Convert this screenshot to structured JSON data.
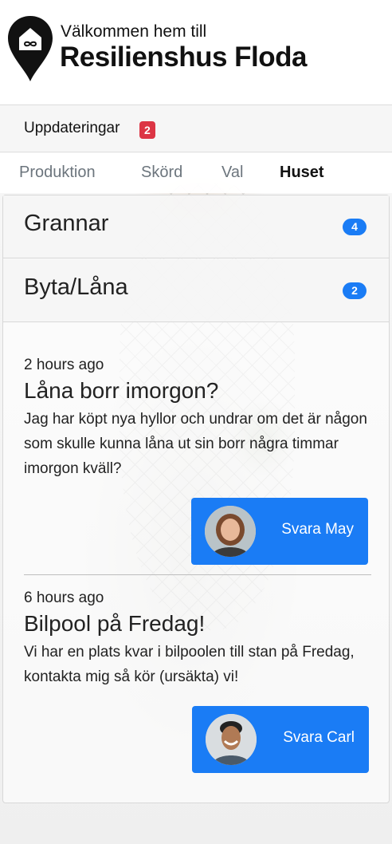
{
  "header": {
    "welcome": "Välkommen hem till",
    "site_name": "Resilienshus Floda"
  },
  "updates": {
    "label": "Uppdateringar",
    "count": "2"
  },
  "tabs": [
    {
      "label": "Produktion",
      "active": false
    },
    {
      "label": "Skörd",
      "active": false
    },
    {
      "label": "Val",
      "active": false
    },
    {
      "label": "Huset",
      "active": true
    }
  ],
  "groups": [
    {
      "label": "Grannar",
      "count": "4"
    },
    {
      "label": "Byta/Låna",
      "count": "2"
    }
  ],
  "posts": [
    {
      "time": "2 hours ago",
      "title": "Låna borr imorgon?",
      "body": "Jag har köpt nya hyllor och undrar om det är någon som skulle kunna låna ut sin borr några timmar imorgon kväll?",
      "reply_label": "Svara May"
    },
    {
      "time": "6 hours ago",
      "title": "Bilpool på Fredag!",
      "body": "Vi har en plats kvar i bilpoolen till stan på Fredag, kontakta mig så kör (ursäkta) vi!",
      "reply_label": "Svara Carl"
    }
  ],
  "colors": {
    "primary": "#1a7cf5",
    "danger": "#dc3545"
  }
}
